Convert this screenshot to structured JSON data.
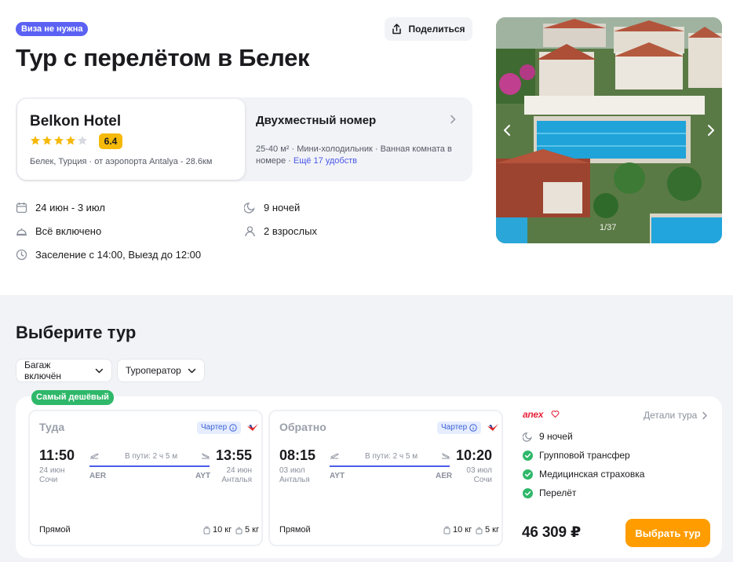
{
  "header": {
    "visa_badge": "Виза не нужна",
    "share_label": "Поделиться",
    "title": "Тур с перелётом в Белек"
  },
  "hotel": {
    "name": "Belkon Hotel",
    "stars": 4,
    "rating": "6.4",
    "location": "Белек, Турция · от аэропорта Antalya - 28.6км"
  },
  "room": {
    "title": "Двухместный номер",
    "features": "25-40 м² · Мини-холодильник · Ванная комната в номере · ",
    "more_link": "Ещё 17 удобств"
  },
  "trip": {
    "dates": "24 июн - 3 июл",
    "nights": "9 ночей",
    "meal": "Всё включено",
    "guests": "2 взрослых",
    "checkin": "Заселение с 14:00, Выезд до 12:00"
  },
  "gallery": {
    "counter": "1/37"
  },
  "tours": {
    "section_title": "Выберите тур",
    "filters": [
      "Багаж включён",
      "Туроператор"
    ],
    "offer": {
      "badge": "Самый дешёвый",
      "outbound": {
        "title": "Туда",
        "charter": "Чартер",
        "dep_time": "11:50",
        "dep_date": "24 июн",
        "dep_city": "Сочи",
        "dep_code": "AER",
        "duration": "В пути: 2 ч 5 м",
        "arr_time": "13:55",
        "arr_date": "24 июн",
        "arr_city": "Анталья",
        "arr_code": "AYT",
        "type": "Прямой",
        "bag_checked": "10 кг",
        "bag_hand": "5 кг"
      },
      "return": {
        "title": "Обратно",
        "charter": "Чартер",
        "dep_time": "08:15",
        "dep_date": "03 июл",
        "dep_city": "Анталья",
        "dep_code": "AYT",
        "duration": "В пути: 2 ч 5 м",
        "arr_time": "10:20",
        "arr_date": "03 июл",
        "arr_city": "Сочи",
        "arr_code": "AER",
        "type": "Прямой",
        "bag_checked": "10 кг",
        "bag_hand": "5 кг"
      },
      "operator": "anex",
      "details_label": "Детали тура",
      "includes": [
        "9 ночей",
        "Групповой трансфер",
        "Медицинская страховка",
        "Перелёт"
      ],
      "price": "46 309 ₽",
      "choose_label": "Выбрать тур"
    }
  },
  "colors": {
    "accent": "#5b62f3",
    "orange": "#ff9d00",
    "green": "#2fb86a",
    "star": "#f5b90a"
  }
}
